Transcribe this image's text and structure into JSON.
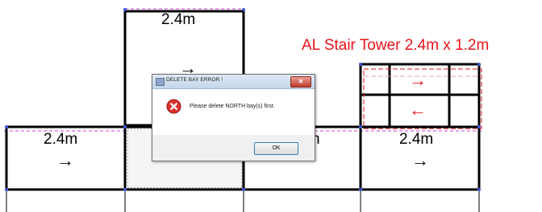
{
  "drawing": {
    "top_bay_dim": "2.4m",
    "left_bay_dim": "2.4m",
    "right_bay_dim": "2.4m",
    "partial_label": "n",
    "arrow_right": "→",
    "arrow_right_red": "→",
    "arrow_left_red": "←",
    "tower_label": "AL Stair Tower 2.4m x 1.2m",
    "colors": {
      "frame": "#000000",
      "tower": "#e8141b",
      "dashed_magenta": "#d63cd6",
      "node": "#3a55d8"
    }
  },
  "dialog": {
    "title": "DELETE BAY ERROR !",
    "close_label": "✕",
    "message": "Please delete NORTH bay(s) first.",
    "ok_label": "OK",
    "icon": "error-icon"
  }
}
